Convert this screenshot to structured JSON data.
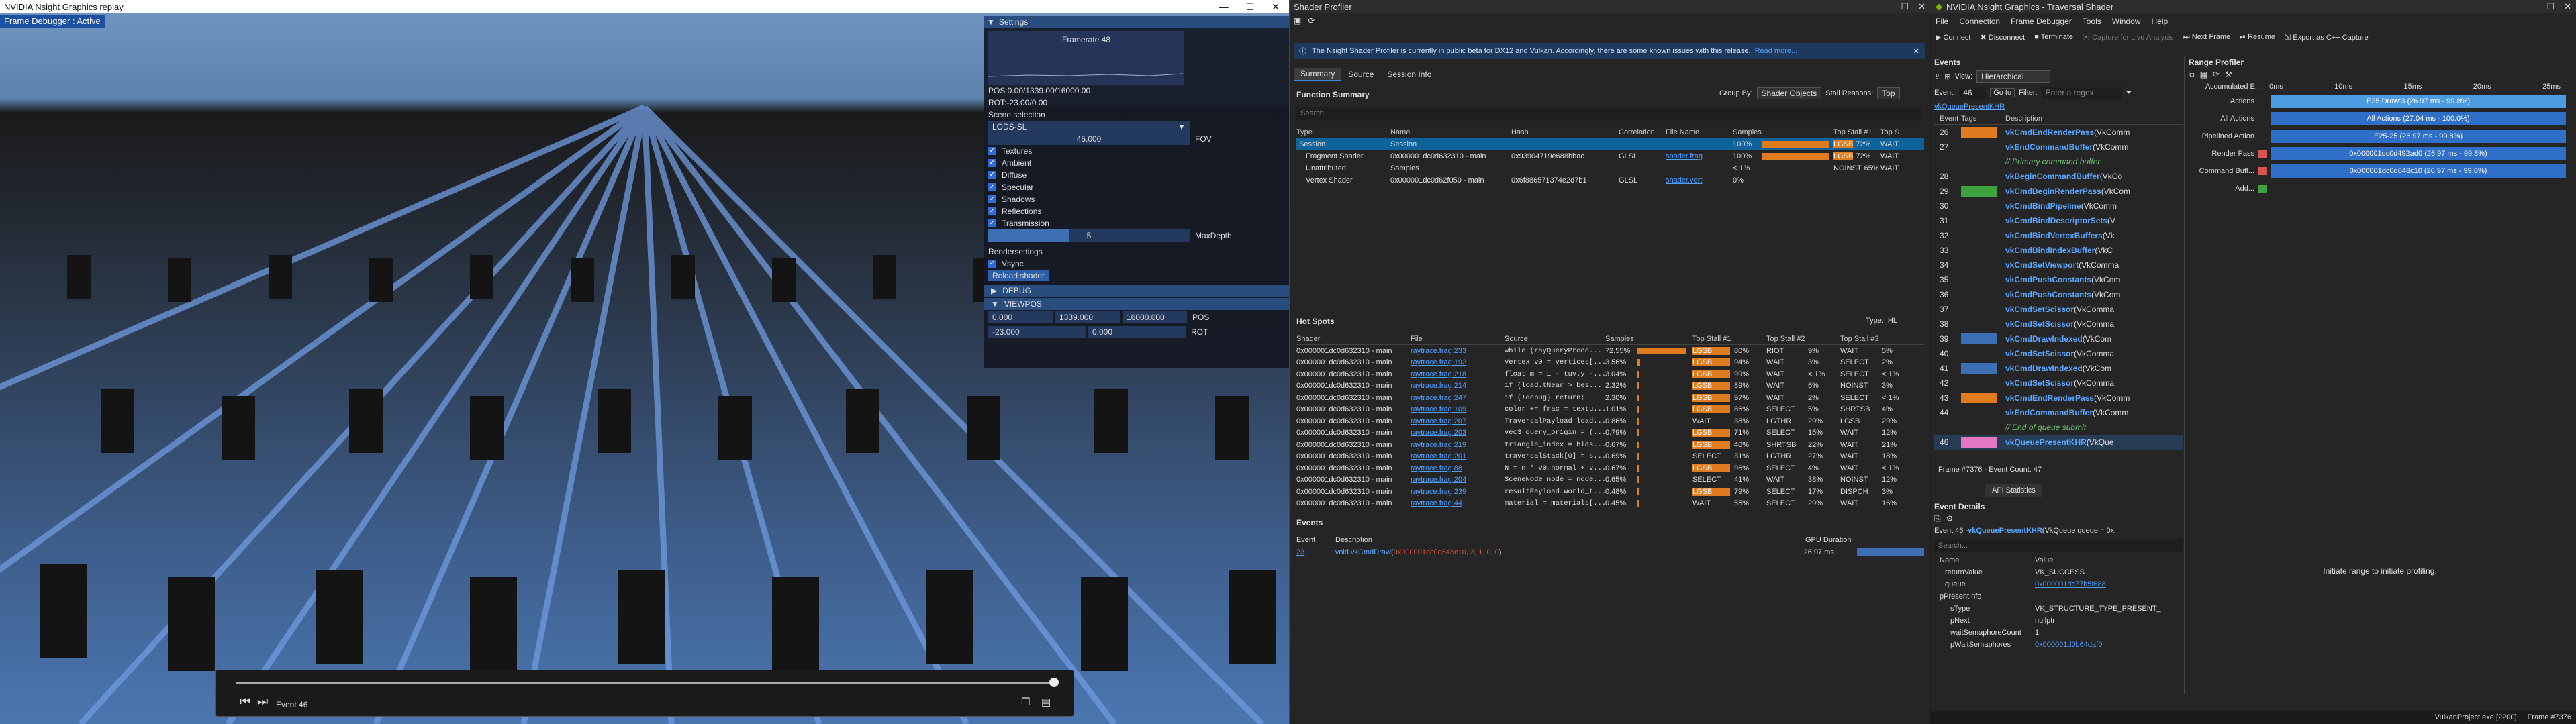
{
  "replay": {
    "title": "NVIDIA Nsight Graphics replay",
    "badge": "Frame Debugger : Active",
    "event_label": "Event 46"
  },
  "settings": {
    "title": "Settings",
    "framerate": "Framerate 48",
    "pos": "POS:0.00/1339.00/16000.00",
    "rot": "ROT:-23.00/0.00",
    "scene_selection": "Scene selection",
    "scene_value": "LODS-SL",
    "fov_value": "45.000",
    "fov_label": "FOV",
    "checks": [
      "Textures",
      "Ambient",
      "Diffuse",
      "Specular",
      "Shadows",
      "Reflections",
      "Transmission"
    ],
    "maxdepth_value": "5",
    "maxdepth_label": "MaxDepth",
    "render_settings": "Rendersettings",
    "vsync": "Vsync",
    "reload": "Reload shader",
    "debug": "DEBUG",
    "viewpos": "VIEWPOS",
    "vp_x": "0.000",
    "vp_y": "1339.000",
    "vp_z": "16000.000",
    "vp_pos": "POS",
    "vr_x": "-23.000",
    "vr_y": "0.000",
    "vp_rot": "ROT"
  },
  "profiler": {
    "title": "Shader Profiler",
    "notice": "The Nsight Shader Profiler is currently in public beta for DX12 and Vulkan. Accordingly, there are some known issues with this release.",
    "read_more": "Read more...",
    "tabs": [
      "Summary",
      "Source",
      "Session Info"
    ],
    "fs_title": "Function Summary",
    "group_by": "Group By:",
    "group_val": "Shader Objects",
    "stall": "Stall Reasons:",
    "stall_val": "Top",
    "search": "Search...",
    "fs_cols": [
      "Type",
      "Name",
      "Hash",
      "Correlation",
      "File Name",
      "Samples",
      "Top Stall #1",
      "Top S"
    ],
    "fs_rows": [
      {
        "type": "Session",
        "name": "Session",
        "hash": "",
        "corr": "",
        "file": "",
        "samples": "100%",
        "st1": "LGSB",
        "st1p": "72%",
        "st2": "WAIT"
      },
      {
        "type": "Fragment Shader",
        "name": "0x000001dc0d632310 - main",
        "hash": "0x93904719e688bbac",
        "corr": "GLSL",
        "file": "shader.frag",
        "samples": "100%",
        "st1": "LGSB",
        "st1p": "72%",
        "st2": "WAIT"
      },
      {
        "type": "Unattributed",
        "name": "Samples",
        "hash": "",
        "corr": "",
        "file": "",
        "samples": "< 1%",
        "st1": "NOINST",
        "st1p": "65%",
        "st2": "WAIT"
      },
      {
        "type": "Vertex Shader",
        "name": "0x000001dc0d62f050 - main",
        "hash": "0x6f886571374e2d7b1",
        "corr": "GLSL",
        "file": "shader.vert",
        "samples": "0%",
        "st1": "",
        "st1p": "",
        "st2": ""
      }
    ],
    "hs_title": "Hot Spots",
    "hs_type": "Type:",
    "hs_type_val": "HL",
    "hs_cols": [
      "Shader",
      "File",
      "Source",
      "Samples",
      "Top Stall #1",
      "Top Stall #2",
      "Top Stall #3"
    ],
    "hs_rows": [
      [
        "0x000001dc0d632310 - main",
        "raytrace.frag:233",
        "while (rayQueryProce...",
        "72.55%",
        "LGSB",
        "80%",
        "RIOT",
        "9%",
        "WAIT",
        "5%"
      ],
      [
        "0x000001dc0d632310 - main",
        "raytrace.frag:192",
        "Vertex v0 = vertices[...",
        "3.56%",
        "LGSB",
        "94%",
        "WAIT",
        "3%",
        "SELECT",
        "2%"
      ],
      [
        "0x000001dc0d632310 - main",
        "raytrace.frag:218",
        "float m = 1 - tuv.y -...",
        "3.04%",
        "LGSB",
        "99%",
        "WAIT",
        "< 1%",
        "SELECT",
        "< 1%"
      ],
      [
        "0x000001dc0d632310 - main",
        "raytrace.frag:214",
        "if (load.tNear > bes...",
        "2.32%",
        "LGSB",
        "89%",
        "WAIT",
        "6%",
        "NOINST",
        "3%"
      ],
      [
        "0x000001dc0d632310 - main",
        "raytrace.frag:247",
        "if (!debug) return;",
        "2.30%",
        "LGSB",
        "97%",
        "WAIT",
        "2%",
        "SELECT",
        "< 1%"
      ],
      [
        "0x000001dc0d632310 - main",
        "raytrace.frag:109",
        "color += frac = textu...",
        "1.01%",
        "LGSB",
        "86%",
        "SELECT",
        "5%",
        "SHRTSB",
        "4%"
      ],
      [
        "0x000001dc0d632310 - main",
        "raytrace.frag:207",
        "TraversalPayload load...",
        "0.86%",
        "WAIT",
        "38%",
        "LGTHR",
        "29%",
        "LGSB",
        "29%"
      ],
      [
        "0x000001dc0d632310 - main",
        "raytrace.frag:203",
        "vec3 query_origin = (...",
        "0.79%",
        "LGSB",
        "71%",
        "SELECT",
        "15%",
        "WAIT",
        "12%"
      ],
      [
        "0x000001dc0d632310 - main",
        "raytrace.frag:219",
        "triangle_index = blas...",
        "0.67%",
        "LGSB",
        "40%",
        "SHRTSB",
        "22%",
        "WAIT",
        "21%"
      ],
      [
        "0x000001dc0d632310 - main",
        "raytrace.frag:201",
        "traversalStack[0] = s...",
        "0.69%",
        "SELECT",
        "31%",
        "LGTHR",
        "27%",
        "WAIT",
        "18%"
      ],
      [
        "0x000001dc0d632310 - main",
        "raytrace.frag:88",
        "N = n * v0.normal + v...",
        "0.67%",
        "LGSB",
        "96%",
        "SELECT",
        "4%",
        "WAIT",
        "< 1%"
      ],
      [
        "0x000001dc0d632310 - main",
        "raytrace.frag:204",
        "SceneNode node = node...",
        "0.65%",
        "SELECT",
        "41%",
        "WAIT",
        "38%",
        "NOINST",
        "12%"
      ],
      [
        "0x000001dc0d632310 - main",
        "raytrace.frag:239",
        "resultPayload.world_t...",
        "0.48%",
        "LGSB",
        "79%",
        "SELECT",
        "17%",
        "DISPCH",
        "3%"
      ],
      [
        "0x000001dc0d632310 - main",
        "raytrace.frag:44",
        "material = materials[...",
        "0.45%",
        "WAIT",
        "55%",
        "SELECT",
        "29%",
        "WAIT",
        "16%"
      ]
    ],
    "ev_title": "Events",
    "ev_cols": [
      "Event",
      "Description",
      "GPU Duration"
    ],
    "ev_num": "23",
    "ev_desc_pre": "void vkCmdDraw(",
    "ev_desc_args": "0x000001dc0d648c10, 3, 1, 0, 0",
    "ev_desc_post": ")",
    "ev_dur": "26.97 ms"
  },
  "nsight": {
    "title": "NVIDIA Nsight Graphics - Traversal Shader",
    "menus": [
      "File",
      "Connection",
      "Frame Debugger",
      "Tools",
      "Window",
      "Help"
    ],
    "toolbar": [
      "Connect",
      "Disconnect",
      "Terminate",
      "Capture for Live Analysis",
      "Next Frame",
      "Resume",
      "Export as C++ Capture"
    ],
    "events_title": "Events",
    "view_label": "View:",
    "view_val": "Hierarchical",
    "event_label": "Event:",
    "event_val": "46",
    "goto": "Go to",
    "filter_label": "Filter:",
    "filter_ph": "Enter a regex",
    "breadcrumb": "vkQueuePresentKHR",
    "ev_cols": [
      "Event",
      "Tags",
      "Description"
    ],
    "ev_rows": [
      {
        "n": "26",
        "tag": "orange",
        "d": "vkCmdEndRenderPass",
        "a": "(VkComm"
      },
      {
        "n": "27",
        "tag": "",
        "d": "vkEndCommandBuffer",
        "a": "(VkComm"
      },
      {
        "n": "",
        "tag": "",
        "d": "// Primary command buffer",
        "a": "",
        "comment": true
      },
      {
        "n": "28",
        "tag": "",
        "d": "vkBeginCommandBuffer",
        "a": "(VkCo"
      },
      {
        "n": "29",
        "tag": "green",
        "d": "vkCmdBeginRenderPass",
        "a": "(VkCom"
      },
      {
        "n": "30",
        "tag": "",
        "d": "vkCmdBindPipeline",
        "a": "(VkComm"
      },
      {
        "n": "31",
        "tag": "",
        "d": "vkCmdBindDescriptorSets",
        "a": "(V"
      },
      {
        "n": "32",
        "tag": "",
        "d": "vkCmdBindVertexBuffers",
        "a": "(Vk"
      },
      {
        "n": "33",
        "tag": "",
        "d": "vkCmdBindIndexBuffer",
        "a": "(VkC"
      },
      {
        "n": "34",
        "tag": "",
        "d": "vkCmdSetViewport",
        "a": "(VkComma"
      },
      {
        "n": "35",
        "tag": "",
        "d": "vkCmdPushConstants",
        "a": "(VkCom"
      },
      {
        "n": "36",
        "tag": "",
        "d": "vkCmdPushConstants",
        "a": "(VkCom"
      },
      {
        "n": "37",
        "tag": "",
        "d": "vkCmdSetScissor",
        "a": "(VkComma"
      },
      {
        "n": "38",
        "tag": "",
        "d": "vkCmdSetScissor",
        "a": "(VkComma"
      },
      {
        "n": "39",
        "tag": "blue",
        "d": "vkCmdDrawIndexed",
        "a": "(VkCom"
      },
      {
        "n": "40",
        "tag": "",
        "d": "vkCmdSetScissor",
        "a": "(VkComma"
      },
      {
        "n": "41",
        "tag": "blue",
        "d": "vkCmdDrawIndexed",
        "a": "(VkCom"
      },
      {
        "n": "42",
        "tag": "",
        "d": "vkCmdSetScissor",
        "a": "(VkComma"
      },
      {
        "n": "43",
        "tag": "orange",
        "d": "vkCmdEndRenderPass",
        "a": "(VkComm"
      },
      {
        "n": "44",
        "tag": "",
        "d": "vkEndCommandBuffer",
        "a": "(VkComm"
      },
      {
        "n": "",
        "tag": "",
        "d": "// End of queue submit",
        "a": "",
        "comment": true
      },
      {
        "n": "46",
        "tag": "pink",
        "d": "vkQueuePresentKHR",
        "a": "(VkQue"
      }
    ],
    "frame_info": "Frame #7376 - Event Count: 47",
    "api_tab": "API Statistics",
    "details_title": "Event Details",
    "details_event": "Event 46 - ",
    "details_fn": "vkQueuePresentKHR",
    "details_args": "(VkQueue queue = 0x",
    "details_search": "Search...",
    "dcols": [
      "Name",
      "Value"
    ],
    "drows": [
      {
        "k": "returnValue",
        "v": "VK_SUCCESS",
        "indent": 1,
        "link": false
      },
      {
        "k": "queue",
        "v": "0x000001dc77b5f688",
        "indent": 1,
        "link": true
      },
      {
        "k": "pPresentInfo",
        "v": "",
        "indent": 0,
        "link": false
      },
      {
        "k": "sType",
        "v": "VK_STRUCTURE_TYPE_PRESENT_",
        "indent": 2,
        "link": false
      },
      {
        "k": "pNext",
        "v": "nullptr",
        "indent": 2,
        "link": false
      },
      {
        "k": "waitSemaphoreCount",
        "v": "1",
        "indent": 2,
        "link": false
      },
      {
        "k": "pWaitSemaphores",
        "v": "0x000001d0b64daf0",
        "indent": 2,
        "link": true
      }
    ],
    "range_title": "Range Profiler",
    "accumulated": "Accumulated E...",
    "ticks": [
      "0ms",
      "10ms",
      "15ms",
      "20ms",
      "25ms"
    ],
    "rows": [
      {
        "label": "Actions",
        "bar": "E25 Draw:3 (26.97 ms - 99.8%)",
        "light": true
      },
      {
        "label": "All Actions",
        "bar": "All Actions (27.04 ms - 100.0%)",
        "light": false
      },
      {
        "label": "Pipelined Action",
        "bar": "E25-25 (26.97 ms - 99.8%)",
        "light": false
      },
      {
        "label": "Render Pass",
        "bar": "0x000001dc0d492ad0 (26.97 ms - 99.8%)",
        "light": false
      },
      {
        "label": "Command Buff...",
        "bar": "0x000001dc0d648c10 (26.97 ms - 99.8%)",
        "light": false
      },
      {
        "label": "Add...",
        "bar": "",
        "light": false
      }
    ],
    "select_hint": "Initiate range to initiate profiling.",
    "status_app": "VulkanProject.exe [2200]",
    "status_frame": "Frame #7376"
  }
}
